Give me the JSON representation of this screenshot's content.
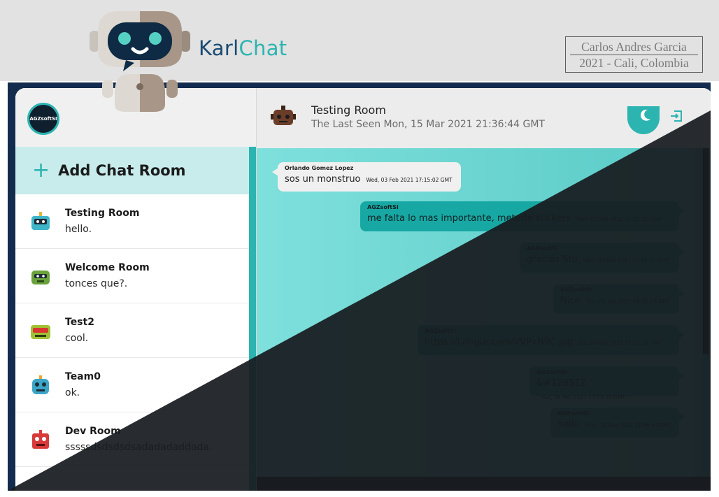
{
  "banner": {
    "brand_part1": "Karl",
    "brand_part2": "Chat",
    "credit_line1": "Carlos Andres Garcia",
    "credit_line2": "2021 - Cali, Colombia"
  },
  "sidebar": {
    "avatar_label": "AGZsoftSI",
    "add_room_label": "Add Chat Room",
    "rooms": [
      {
        "name": "Testing Room",
        "last": "hello.",
        "color": "#3fb5c9"
      },
      {
        "name": "Welcome Room",
        "last": "tonces que?.",
        "color": "#6aa33b"
      },
      {
        "name": "Test2",
        "last": "cool.",
        "color": "#a0c234"
      },
      {
        "name": "Team0",
        "last": "ok.",
        "color": "#3aa6c8"
      },
      {
        "name": "Dev Room",
        "last": "sssssdsdsdsdsadadadaddada.",
        "color": "#d83a3a"
      }
    ]
  },
  "chat": {
    "title": "Testing Room",
    "last_seen": "The Last Seen Mon, 15 Mar 2021 21:36:44 GMT",
    "messages": [
      {
        "author": "Orlando Gomez Lopez",
        "text": "sos un monstruo",
        "time": "Wed, 03 Feb 2021 17:15:02 GMT",
        "side": "in"
      },
      {
        "author": "AGZsoftSI",
        "text": "me falta lo mas importante, meterle stickers",
        "time": "Wed, 03 Feb 2021 17:15:32 GMT",
        "side": "out"
      },
      {
        "author": "AGZsoftSI",
        "text": "gracias Stu",
        "time": "Wed, 03 Feb 2021 17:16:25 GMT",
        "side": "out"
      },
      {
        "author": "AGZsoftSI",
        "text": "Nice",
        "time": "Thu, 04 Feb 2021 19:56:13 GMT",
        "side": "out"
      },
      {
        "author": "AGZsoftSI",
        "text": "https://i.imgur.com/VVPxN9C.jpg",
        "time": "Sat, 06 Feb 2021 17:52:13 GMT",
        "side": "out"
      },
      {
        "author": "AGZsoftSI",
        "text": "&#128512;",
        "time": "Sat, 06 Feb 2021 17:53:30 GMT",
        "side": "out"
      },
      {
        "author": "AGZsoftSI",
        "text": "hello",
        "time": "Mon, 15 Mar 2021 21:36:44 GMT",
        "side": "out"
      }
    ]
  },
  "colors": {
    "accent": "#2cb4b0",
    "navy": "#132c4d",
    "dark": "#1b1e22"
  },
  "icons": [
    "robot-logo",
    "add-icon",
    "moon-icon",
    "exit-icon"
  ]
}
